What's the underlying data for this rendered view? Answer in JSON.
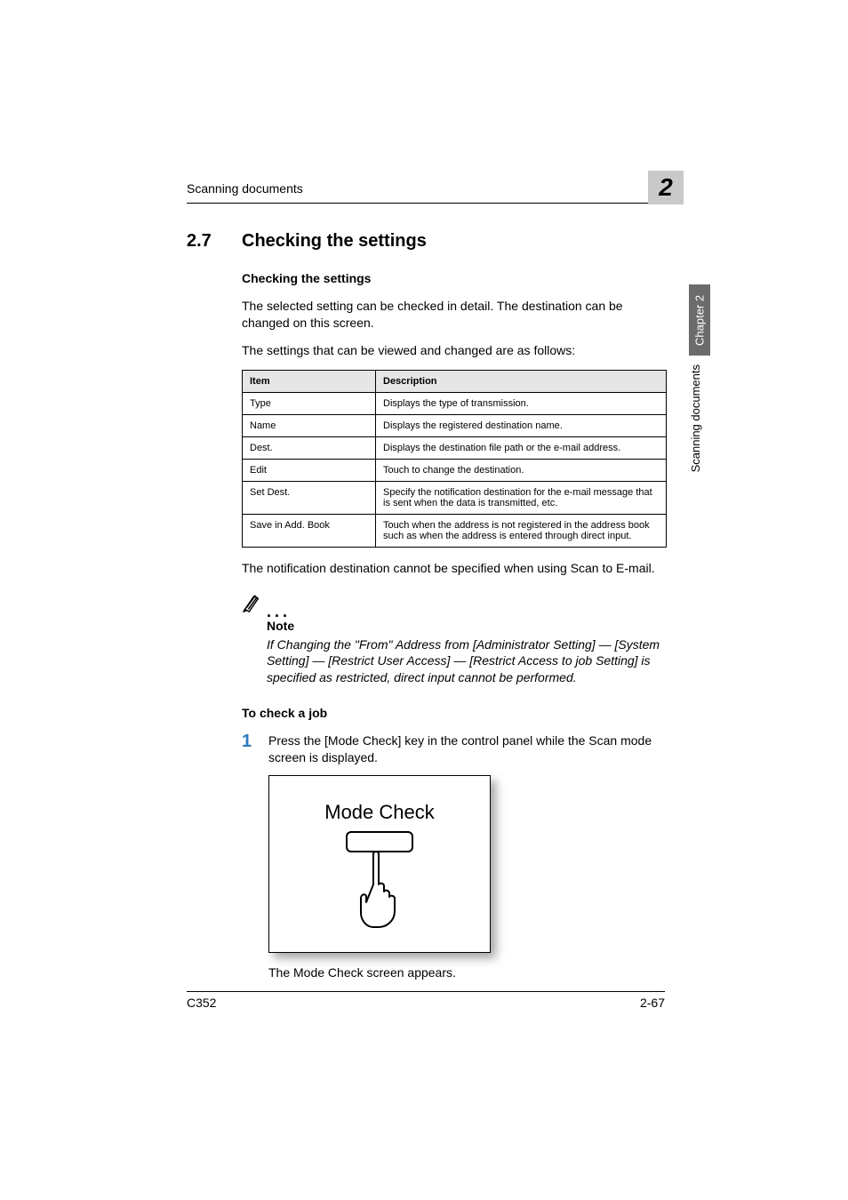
{
  "running_head": "Scanning documents",
  "chapter_box_number": "2",
  "side_tab": "Chapter 2",
  "side_label": "Scanning documents",
  "section": {
    "number": "2.7",
    "title": "Checking the settings",
    "subtitle": "Checking the settings",
    "p1": "The selected setting can be checked in detail. The destination can be changed on this screen.",
    "p2": "The settings that can be viewed and changed are as follows:"
  },
  "table": {
    "headers": {
      "item": "Item",
      "description": "Description"
    },
    "rows": [
      {
        "item": "Type",
        "description": "Displays the type of transmission."
      },
      {
        "item": "Name",
        "description": "Displays the registered destination name."
      },
      {
        "item": "Dest.",
        "description": "Displays the destination file path or the e-mail address."
      },
      {
        "item": "Edit",
        "description": "Touch to change the destination."
      },
      {
        "item": "Set Dest.",
        "description": "Specify the notification destination for the e-mail message that is sent when the data is transmitted, etc."
      },
      {
        "item": "Save in Add. Book",
        "description": "Touch when the address is not registered in the address book such as when the address is entered through direct input."
      }
    ]
  },
  "after_table_p": "The notification destination cannot be specified when using Scan to E-mail.",
  "note": {
    "label": "Note",
    "body": "If Changing the \"From\" Address from [Administrator Setting] — [System Setting] — [Restrict User Access] — [Restrict Access to job Setting] is specified as restricted, direct input cannot be performed."
  },
  "to_check": {
    "heading": "To check a job",
    "step1_num": "1",
    "step1_text": "Press the [Mode Check] key in the control panel while the Scan mode screen is displayed.",
    "illustration_label": "Mode Check",
    "result": "The Mode Check screen appears."
  },
  "footer": {
    "left": "C352",
    "right": "2-67"
  }
}
